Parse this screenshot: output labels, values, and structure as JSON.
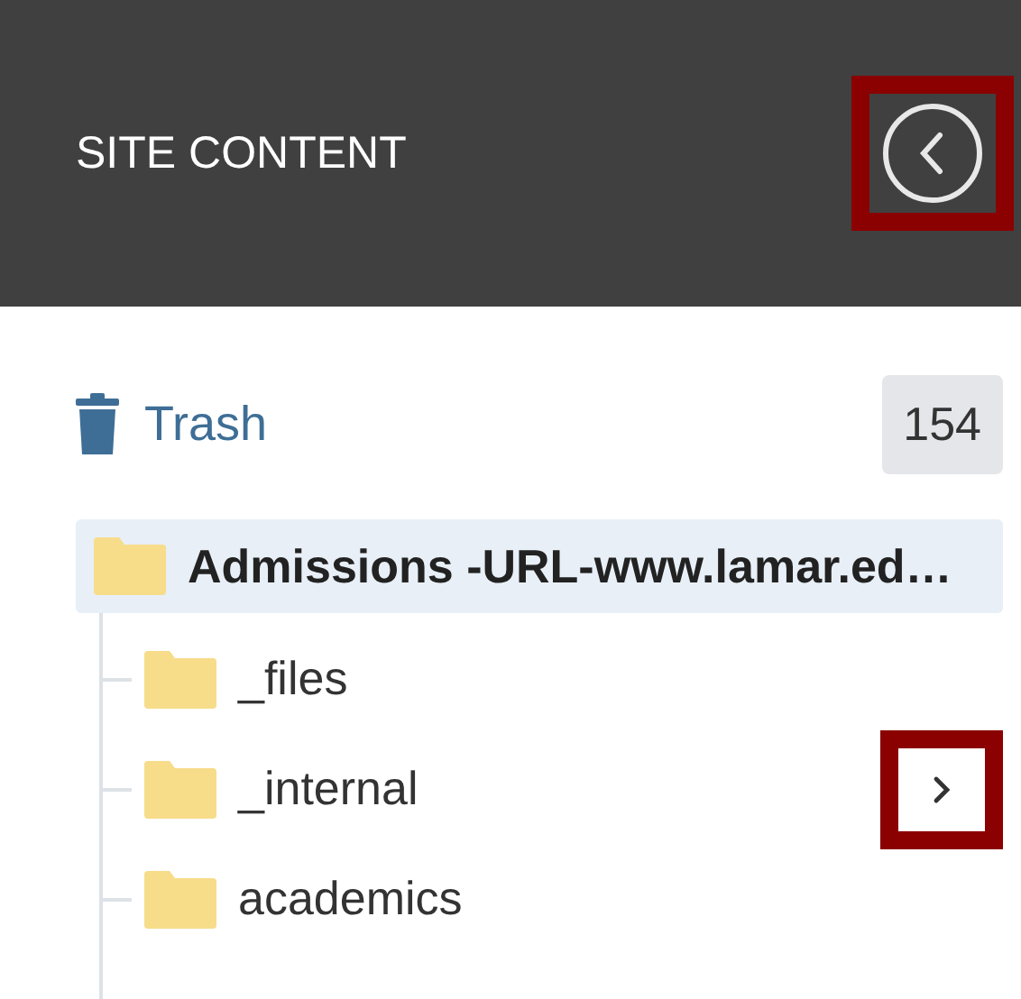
{
  "header": {
    "title": "SITE CONTENT",
    "collapse_button": {
      "highlighted": true
    }
  },
  "trash": {
    "label": "Trash",
    "count": "154"
  },
  "tree": [
    {
      "label": "Admissions -URL-www.lamar.ed…",
      "selected": true,
      "children": [
        {
          "label": "_files",
          "selected": false,
          "highlighted": false
        },
        {
          "label": "_internal",
          "selected": false,
          "highlighted": true
        },
        {
          "label": "academics",
          "selected": false,
          "highlighted": false
        }
      ]
    }
  ]
}
